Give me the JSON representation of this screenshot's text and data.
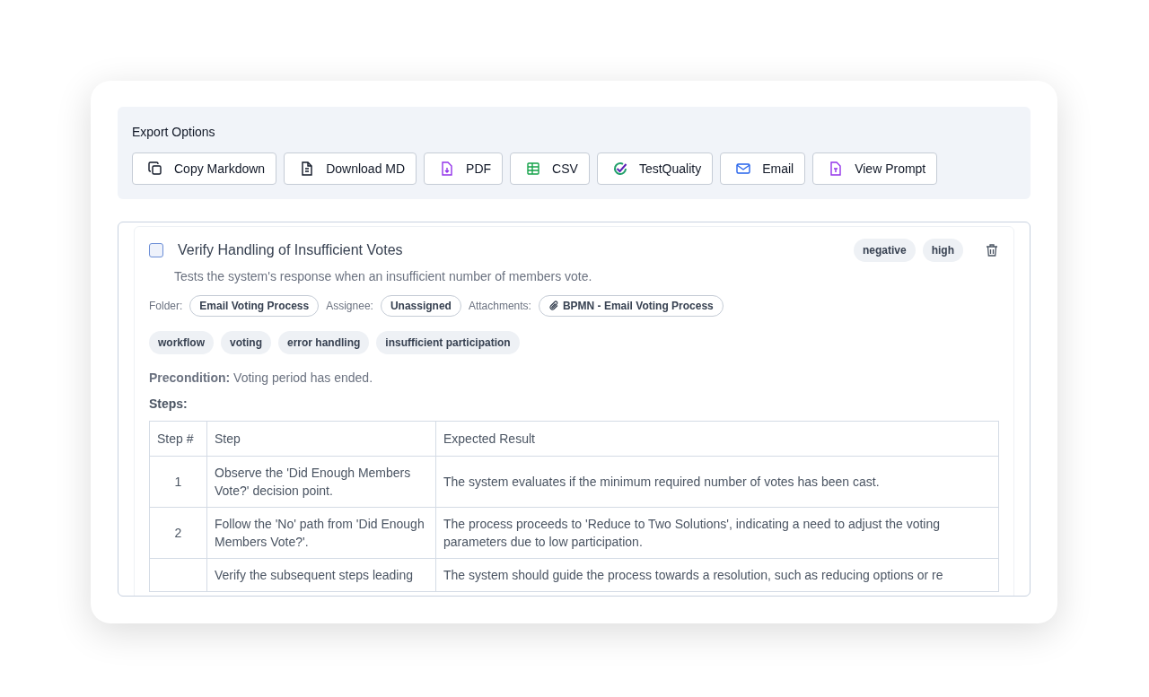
{
  "export_options": {
    "title": "Export Options",
    "buttons": [
      {
        "label": "Copy Markdown"
      },
      {
        "label": "Download MD"
      },
      {
        "label": "PDF"
      },
      {
        "label": "CSV"
      },
      {
        "label": "TestQuality"
      },
      {
        "label": "Email"
      },
      {
        "label": "View Prompt"
      }
    ]
  },
  "test_case": {
    "checked": false,
    "title": "Verify Handling of Insufficient Votes",
    "badges": [
      "negative",
      "high"
    ],
    "description": "Tests the system's response when an insufficient number of members vote.",
    "meta": [
      {
        "label": "Folder:",
        "value": "Email Voting Process",
        "kind": "plain"
      },
      {
        "label": "Assignee:",
        "value": "Unassigned",
        "kind": "plain"
      },
      {
        "label": "Attachments:",
        "value": "BPMN - Email Voting Process",
        "kind": "attachment"
      }
    ],
    "tags": [
      "workflow",
      "voting",
      "error handling",
      "insufficient participation"
    ],
    "precondition": "**Precondition:** Voting period has ended.",
    "steps_label": "Steps:",
    "table": {
      "columns": [
        "Step #",
        "Step",
        "Expected Result"
      ],
      "rows": [
        {
          "number": "1",
          "step": "Observe the 'Did Enough Members Vote?' decision point.",
          "expected": "The system evaluates if the minimum required number of votes has been cast."
        },
        {
          "number": "2",
          "step": "Follow the 'No' path from 'Did Enough Members Vote?'.",
          "expected": "The process proceeds to 'Reduce to Two Solutions', indicating a need to adjust the voting parameters due to low participation."
        },
        {
          "step": "Verify the subsequent steps leading",
          "expected": "The system should guide the process towards a resolution, such as reducing options or re"
        }
      ]
    }
  }
}
